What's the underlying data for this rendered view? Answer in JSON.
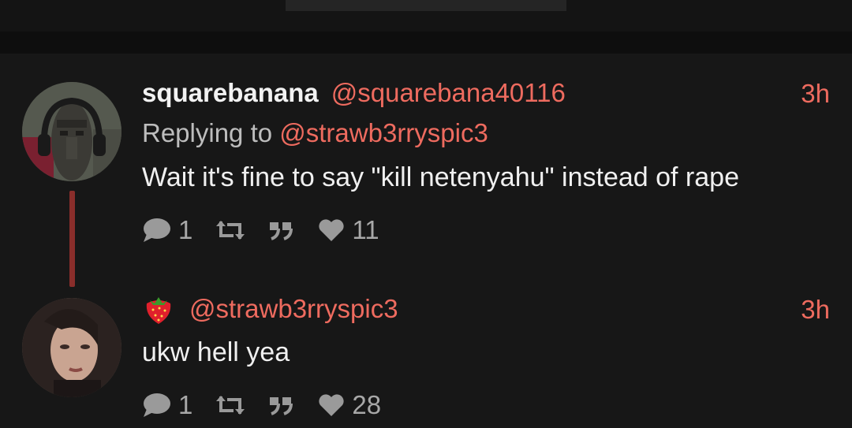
{
  "posts": [
    {
      "display_name": "squarebanana",
      "handle": "@squarebana40116",
      "time": "3h",
      "reply_prefix": "Replying to ",
      "reply_handle": "@strawb3rryspic3",
      "text": "Wait it's fine to say \"kill netenyahu\" instead of rape",
      "avatar_icon": "moai-headphones-avatar",
      "actions": {
        "reply_count": "1",
        "like_count": "11"
      }
    },
    {
      "emoji": "strawberry-icon",
      "handle": "@strawb3rryspic3",
      "time": "3h",
      "text": "ukw hell yea",
      "avatar_icon": "woman-portrait-avatar",
      "actions": {
        "reply_count": "1",
        "like_count": "28"
      }
    }
  ],
  "colors": {
    "background": "#171717",
    "accent": "#ee6b5f",
    "thread_line": "#8a2e2b",
    "icon": "#9a9a9a"
  }
}
